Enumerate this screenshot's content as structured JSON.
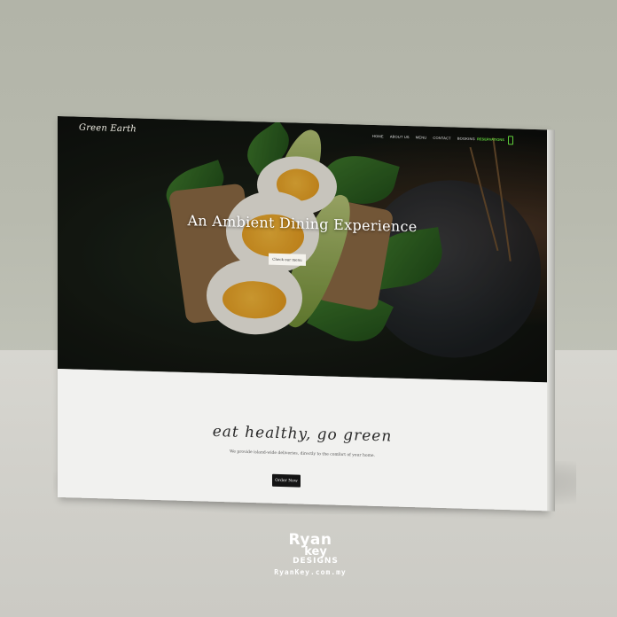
{
  "site": {
    "logo_text": "Green Earth",
    "nav": {
      "items": [
        "HOME",
        "ABOUT US",
        "MENU",
        "CONTACT",
        "BOOKING"
      ],
      "reservations_label": "RESERVATIONS"
    },
    "hero": {
      "title": "An Ambient Dining Experience",
      "button_label": "Check our menu"
    },
    "section": {
      "tagline": "eat healthy, go green",
      "subtext": "We provide island-wide deliveries, directly to the comfort of your home.",
      "button_label": "Order Now"
    },
    "colors": {
      "accent": "#5fcf3b",
      "hero_overlay": "#0c0d0b",
      "section_bg": "#f1f1ef",
      "button_dark": "#141414"
    }
  },
  "watermark": {
    "line1": "Ryan",
    "line2": "key",
    "line3": "DESIGNS",
    "line4": "RyanKey.com.my"
  },
  "icons": {
    "phone": "phone-icon"
  }
}
